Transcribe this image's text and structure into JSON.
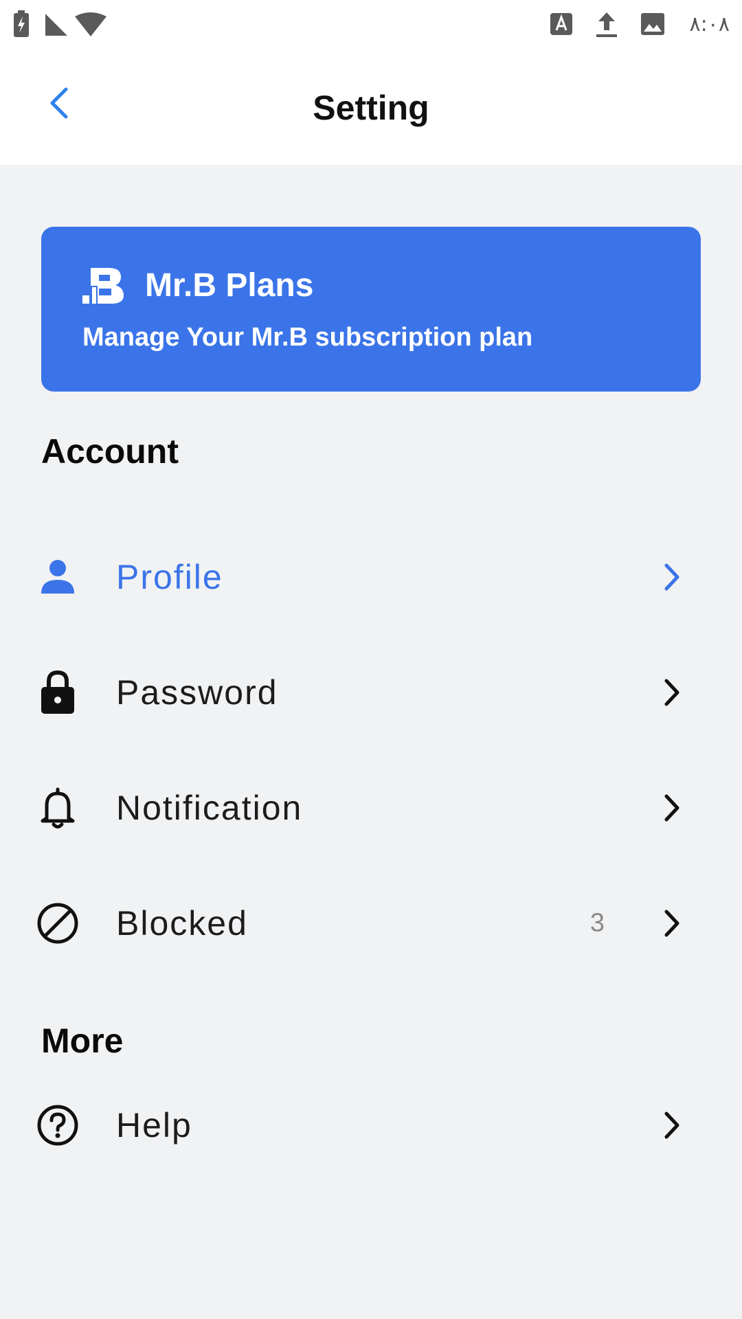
{
  "status_bar": {
    "time": "٨:٠٨",
    "left_icons": [
      "battery-charging-icon",
      "cell-signal-icon",
      "wifi-icon"
    ],
    "right_icons": [
      "font-icon",
      "upload-icon",
      "image-icon"
    ]
  },
  "header": {
    "title": "Setting",
    "back_icon": "chevron-left-icon"
  },
  "plan_card": {
    "title": "Mr.B Plans",
    "subtitle": "Manage Your Mr.B subscription plan",
    "logo_icon": "mrb-logo-icon",
    "background_color": "#3b74e8"
  },
  "account": {
    "heading": "Account",
    "items": [
      {
        "label": "Profile",
        "icon": "person-icon",
        "active": true
      },
      {
        "label": "Password",
        "icon": "lock-icon",
        "active": false
      },
      {
        "label": "Notification",
        "icon": "bell-icon",
        "active": false
      },
      {
        "label": "Blocked",
        "icon": "block-icon",
        "active": false,
        "count": "3"
      }
    ]
  },
  "more": {
    "heading": "More",
    "items": [
      {
        "label": "Help",
        "icon": "help-circle-icon",
        "active": false
      }
    ]
  },
  "colors": {
    "accent": "#3b74e8",
    "background": "#f1f2f4",
    "surface": "#ffffff",
    "text": "#1c1c1c",
    "muted": "#8a8a8a"
  }
}
